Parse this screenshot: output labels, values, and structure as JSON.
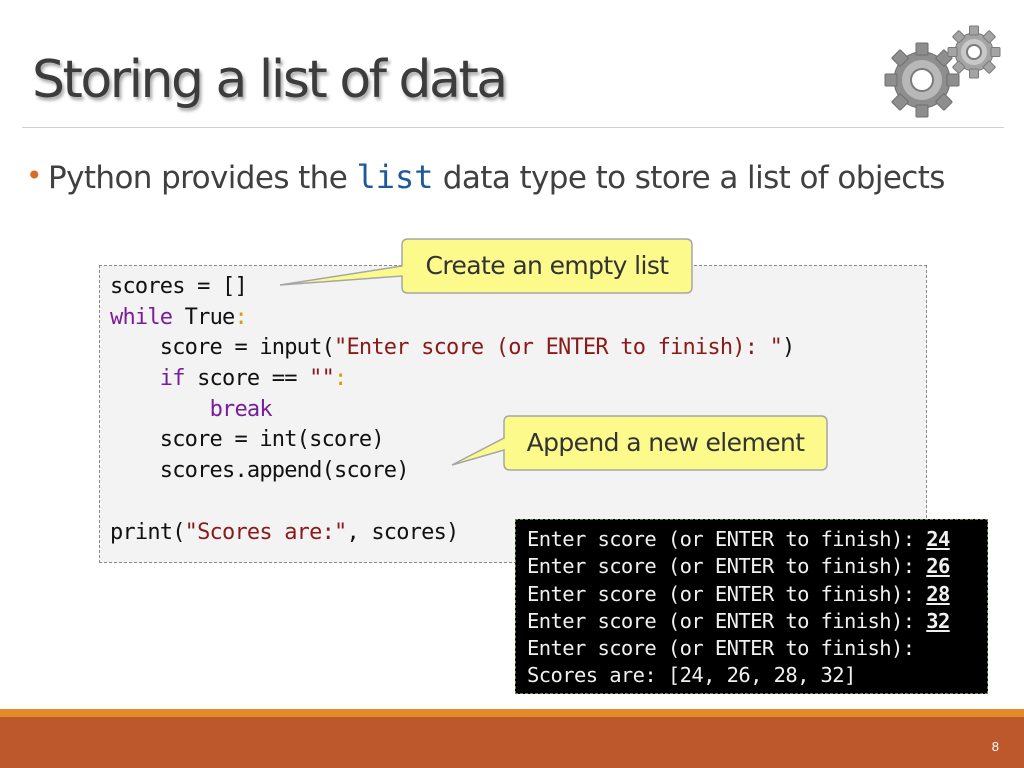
{
  "slide": {
    "title": "Storing a list of data",
    "bullet": {
      "before": "Python provides the ",
      "code": "list",
      "after": " data type to store a list of objects"
    },
    "code": {
      "l1": "scores = []",
      "l2_kw": "while",
      "l2_rest": " True",
      "l2_colon": ":",
      "l3_pre": "    score = input(",
      "l3_str": "\"Enter score (or ENTER to finish): \"",
      "l3_post": ")",
      "l4_indent": "    ",
      "l4_kw": "if",
      "l4_rest": " score == ",
      "l4_str": "\"\"",
      "l4_colon": ":",
      "l5_indent": "        ",
      "l5_kw": "break",
      "l6": "    score = int(score)",
      "l7": "    scores.append(score)",
      "l8": "",
      "l9_pre": "print(",
      "l9_str": "\"Scores are:\"",
      "l9_post": ", scores)"
    },
    "callouts": {
      "empty_list": "Create an empty list",
      "append": "Append a new element"
    },
    "console": {
      "prompt": "Enter score (or ENTER to finish): ",
      "inputs": [
        "24",
        "26",
        "28",
        "32"
      ],
      "result": "Scores are: [24, 26, 28, 32]"
    },
    "page_number": "8",
    "icons": {
      "decoration": "gears-icon"
    },
    "colors": {
      "accent": "#bd582c",
      "stripe": "#e38b2a",
      "bullet": "#d86d28",
      "callout_fill": "#fdfa8c"
    }
  }
}
